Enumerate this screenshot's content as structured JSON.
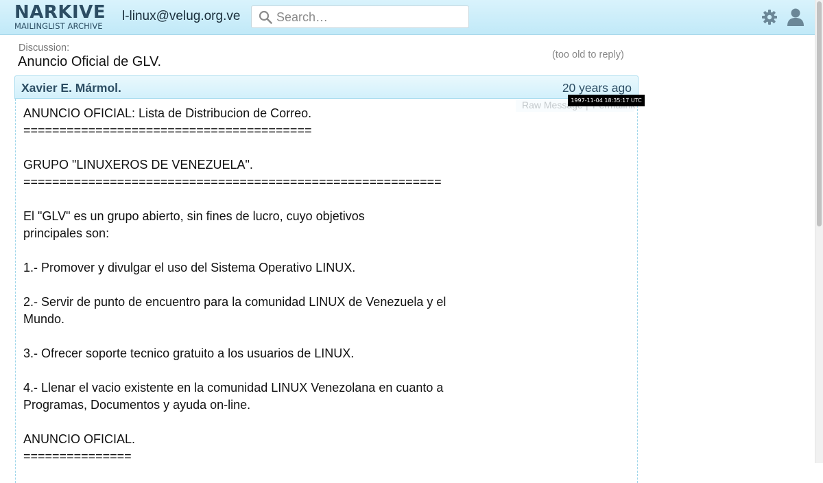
{
  "header": {
    "logo_main": "NARKIVE",
    "logo_sub": "MAILINGLIST ARCHIVE",
    "list_name": "l-linux@velug.org.ve",
    "search_placeholder": "Search…",
    "icons": [
      "search-icon",
      "gear-icon",
      "user-icon"
    ]
  },
  "discussion": {
    "label": "Discussion:",
    "title": "Anuncio Oficial de GLV.",
    "too_old": "(too old to reply)"
  },
  "message": {
    "author": "Xavier E. Mármol.",
    "date_relative": "20 years ago",
    "date_tooltip": "1997-11-04 18:35:17 UTC",
    "raw_message_label": "Raw Message",
    "permalink_label": "Permalink",
    "body_lines": [
      "ANUNCIO OFICIAL: Lista de Distribucion de Correo.",
      "========================================",
      "",
      "GRUPO \"LINUXEROS DE VENEZUELA\".",
      "==========================================================",
      "",
      "El \"GLV\" es un grupo abierto, sin fines de lucro, cuyo objetivos",
      "principales son:",
      "",
      "1.- Promover y divulgar el uso del Sistema Operativo LINUX.",
      "",
      "2.- Servir de punto de encuentro para la comunidad LINUX de Venezuela y el",
      "Mundo.",
      "",
      "3.- Ofrecer soporte tecnico gratuito a los usuarios de LINUX.",
      "",
      "4.- Llenar el vacio existente en la comunidad LINUX Venezolana en cuanto a",
      "Programas, Documentos y ayuda on-line.",
      "",
      "ANUNCIO OFICIAL.",
      "==============="
    ]
  },
  "colors": {
    "topbar": "#c1e9f8",
    "brand": "#2c4d63",
    "message_border": "#a9dcef"
  }
}
